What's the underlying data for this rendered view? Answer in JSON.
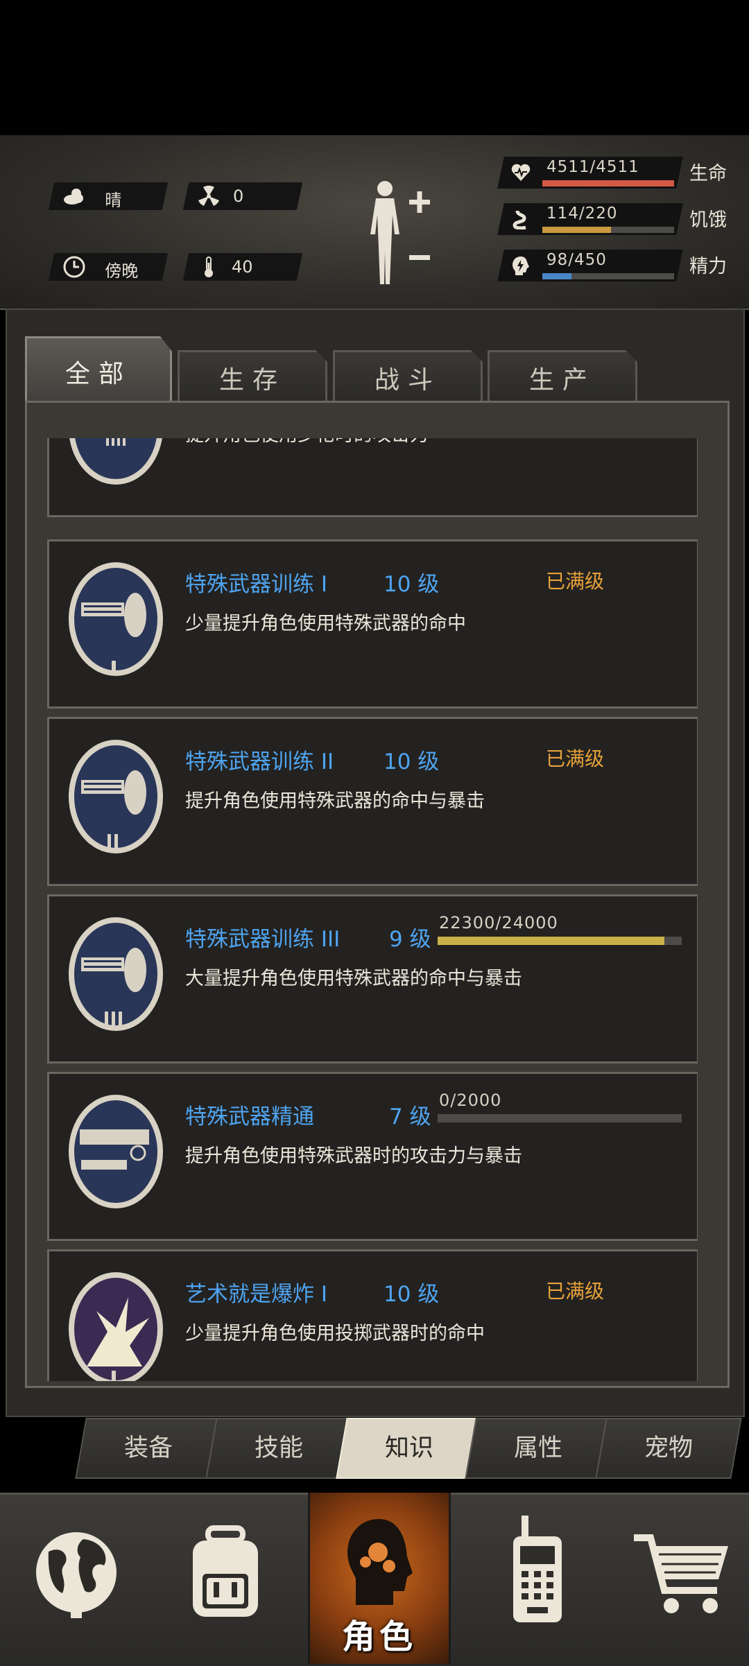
{
  "status": {
    "weather": "晴",
    "radiation": "0",
    "time_of_day": "傍晚",
    "temperature": "40",
    "health": {
      "value": "4511/4511",
      "label": "生命",
      "fill": 1.0,
      "color": "#d45a45"
    },
    "hunger": {
      "value": "114/220",
      "label": "饥饿",
      "fill": 0.52,
      "color": "#c99a3e"
    },
    "energy": {
      "value": "98/450",
      "label": "精力",
      "fill": 0.22,
      "color": "#4a86c8"
    }
  },
  "tabs": [
    "全部",
    "生存",
    "战斗",
    "生产"
  ],
  "knowledge": [
    {
      "name": "",
      "level": "",
      "desc": "提升角色使用步枪时的攻击力",
      "max_label": "",
      "progress_text": "",
      "progress": null
    },
    {
      "name": "特殊武器训练 I",
      "level": "10 级",
      "desc": "少量提升角色使用特殊武器的命中",
      "max_label": "已满级",
      "progress_text": "",
      "progress": null
    },
    {
      "name": "特殊武器训练 II",
      "level": "10 级",
      "desc": "提升角色使用特殊武器的命中与暴击",
      "max_label": "已满级",
      "progress_text": "",
      "progress": null
    },
    {
      "name": "特殊武器训练 III",
      "level": "9 级",
      "desc": "大量提升角色使用特殊武器的命中与暴击",
      "max_label": "",
      "progress_text": "22300/24000",
      "progress": 0.93
    },
    {
      "name": "特殊武器精通",
      "level": "7 级",
      "desc": "提升角色使用特殊武器时的攻击力与暴击",
      "max_label": "",
      "progress_text": "0/2000",
      "progress": 0
    },
    {
      "name": "艺术就是爆炸 I",
      "level": "10 级",
      "desc": "少量提升角色使用投掷武器时的命中",
      "max_label": "已满级",
      "progress_text": "",
      "progress": null
    }
  ],
  "subtabs": [
    "装备",
    "技能",
    "知识",
    "属性",
    "宠物"
  ],
  "nav": {
    "active_label": "角色",
    "icons": [
      "globe-icon",
      "backpack-icon",
      "character-icon",
      "radio-icon",
      "cart-icon"
    ]
  }
}
